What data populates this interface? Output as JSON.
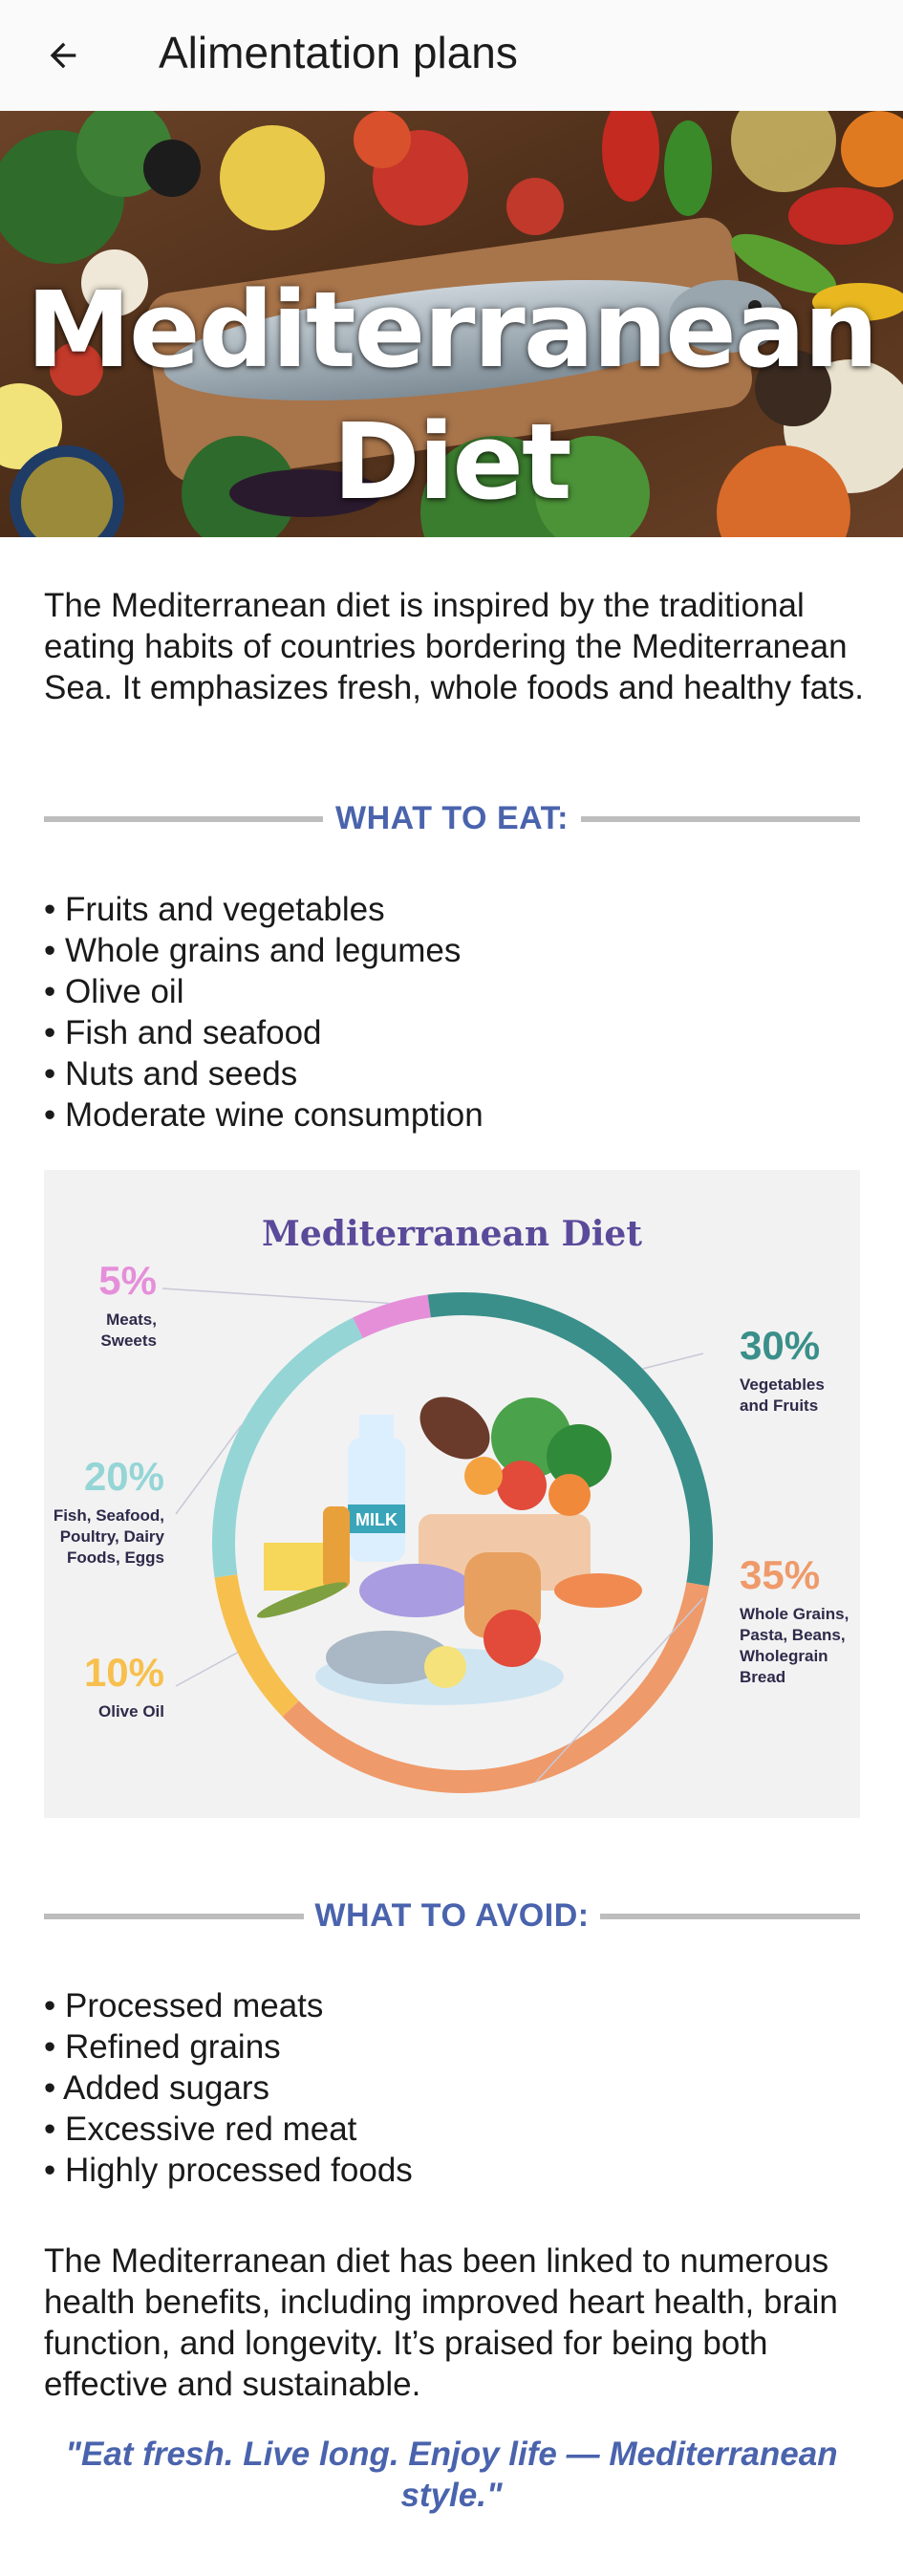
{
  "appbar": {
    "title": "Alimentation plans",
    "back_icon": "arrow-left-icon"
  },
  "hero": {
    "title_line1": "Mediterranean",
    "title_line2": "Diet"
  },
  "intro": "The Mediterranean diet is inspired by the traditional eating habits of countries bordering the Mediterranean Sea. It emphasizes fresh, whole foods and healthy fats.",
  "eat": {
    "heading": "WHAT TO EAT:",
    "items": [
      "Fruits and vegetables",
      "Whole grains and legumes",
      "Olive oil",
      "Fish and seafood",
      "Nuts and seeds",
      "Moderate wine consumption"
    ]
  },
  "chart": {
    "title": "Mediterranean Diet",
    "milk_label": "MILK",
    "colors": {
      "meats": "#e58fd9",
      "vegetables": "#3a8f8a",
      "grains": "#ef9a6a",
      "olive_oil": "#f7c04e",
      "fish": "#95d5d6"
    }
  },
  "chart_data": {
    "type": "pie",
    "title": "Mediterranean Diet",
    "slices": [
      {
        "pct": "5%",
        "value": 5,
        "label": [
          "Meats,",
          "Sweets"
        ]
      },
      {
        "pct": "30%",
        "value": 30,
        "label": [
          "Vegetables",
          "and Fruits"
        ]
      },
      {
        "pct": "35%",
        "value": 35,
        "label": [
          "Whole Grains,",
          "Pasta, Beans,",
          "Wholegrain",
          "Bread"
        ]
      },
      {
        "pct": "10%",
        "value": 10,
        "label": [
          "Olive Oil"
        ]
      },
      {
        "pct": "20%",
        "value": 20,
        "label": [
          "Fish, Seafood,",
          "Poultry, Dairy",
          "Foods, Eggs"
        ]
      }
    ]
  },
  "avoid": {
    "heading": "WHAT TO AVOID:",
    "items": [
      "Processed meats",
      "Refined grains",
      "Added sugars",
      "Excessive red meat",
      "Highly processed foods"
    ]
  },
  "benefits": "The Mediterranean diet has been linked to numerous health benefits, including improved heart health, brain function, and longevity. It’s praised for being both effective and sustainable.",
  "quote": "\"Eat fresh. Live long. Enjoy life — Mediterranean style.\""
}
